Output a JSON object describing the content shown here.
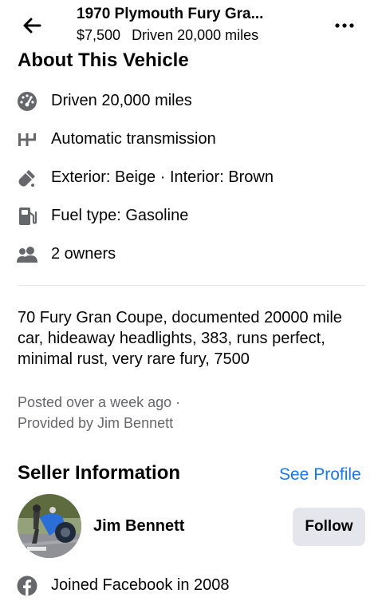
{
  "header": {
    "title": "1970 Plymouth Fury Gra...",
    "price": "$7,500",
    "mileage": "Driven 20,000 miles",
    "back_icon": "arrow-left-icon",
    "more_icon": "more-horizontal-icon"
  },
  "about": {
    "title": "About This Vehicle",
    "specs": [
      {
        "icon": "speedometer-icon",
        "text": "Driven 20,000 miles"
      },
      {
        "icon": "transmission-icon",
        "text": "Automatic transmission"
      },
      {
        "icon": "paint-icon",
        "text": "Exterior: Beige · Interior: Brown"
      },
      {
        "icon": "fuel-pump-icon",
        "text": "Fuel type: Gasoline"
      },
      {
        "icon": "people-icon",
        "text": "2 owners"
      }
    ]
  },
  "description": "70 Fury Gran Coupe, documented 20000 mile car, hideaway headlights, 383, runs perfect, minimal rust, very rare fury, 7500",
  "posted": {
    "time": "Posted over a week ago ·",
    "provider": "Provided by Jim Bennett"
  },
  "seller": {
    "title": "Seller Information",
    "see_profile": "See Profile",
    "name": "Jim Bennett",
    "follow_label": "Follow",
    "joined": "Joined Facebook in 2008",
    "joined_icon": "facebook-icon"
  },
  "colors": {
    "link": "#1877f2",
    "secondary_text": "#65676b",
    "icon_gray": "#65676b",
    "button_bg": "#e4e6eb"
  }
}
